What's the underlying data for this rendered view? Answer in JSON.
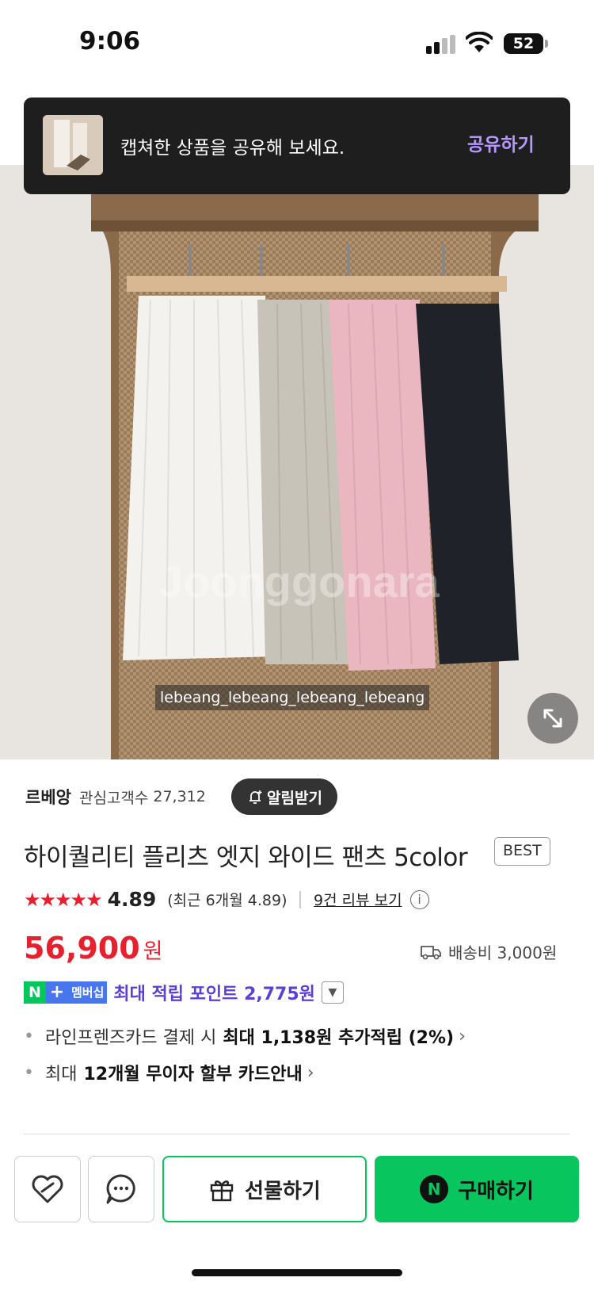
{
  "status_bar": {
    "time": "9:06",
    "battery": "52"
  },
  "share_toast": {
    "message": "캡쳐한 상품을 공유해 보세요.",
    "button": "공유하기"
  },
  "photo": {
    "overlay_text": "lebeang_lebeang_lebeang_lebeang",
    "dot_count": 10,
    "active_dot_index": 1,
    "colors": [
      "#f4f2ef",
      "#c8c3b8",
      "#eab7c0",
      "#1f2329"
    ]
  },
  "seller": {
    "name": "르베앙",
    "follower_label": "관심고객수",
    "follower_count": "27,312",
    "alarm_button": "알림받기"
  },
  "product": {
    "title": "하이퀄리티 플리츠 엣지 와이드 팬츠 5color",
    "badge": "BEST",
    "stars": "★★★★★",
    "rating": "4.89",
    "recent_rating": "(최근 6개월 4.89)",
    "review_link": "9건 리뷰 보기",
    "price": "56,900",
    "price_unit": "원",
    "shipping": "배송비 3,000원"
  },
  "membership": {
    "n": "N",
    "plus": "+",
    "label": "멤버십",
    "points": "최대 적립 포인트 2,775원"
  },
  "benefits": [
    {
      "prefix": "라인프렌즈카드 결제 시",
      "highlight": "최대 1,138원 추가적립 (2%)"
    },
    {
      "prefix": "최대",
      "highlight": "12개월 무이자 할부 카드안내"
    }
  ],
  "bottom_bar": {
    "gift_label": "선물하기",
    "buy_label": "구매하기",
    "npay_icon": "N"
  },
  "colors": {
    "price_red": "#e8202e",
    "naver_green": "#03c75a",
    "membership_blue": "#4876ef",
    "point_purple": "#5b3fd8"
  }
}
